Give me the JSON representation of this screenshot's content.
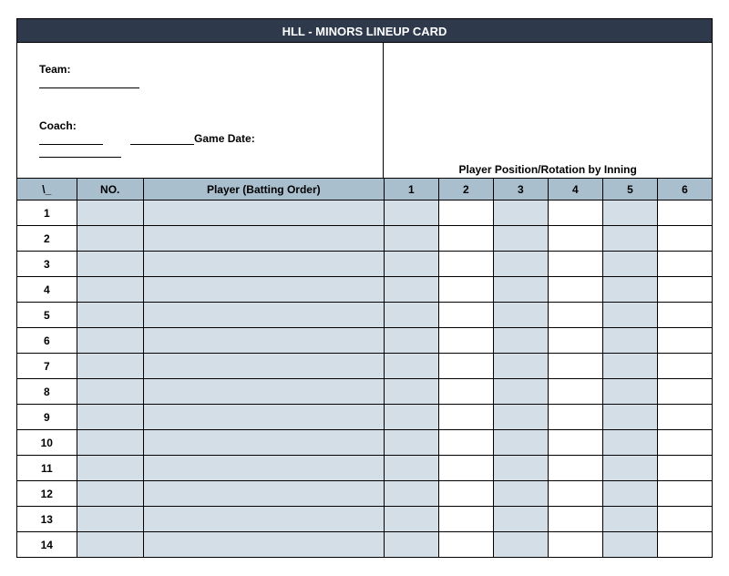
{
  "title": "HLL - MINORS LINEUP CARD",
  "info": {
    "team_label": "Team:",
    "coach_label": "Coach:",
    "date_label": "Game Date:",
    "rotation_label": "Player Position/Rotation by Inning"
  },
  "headers": {
    "corner": "\\_",
    "no": "NO.",
    "player": "Player (Batting Order)",
    "innings": [
      "1",
      "2",
      "3",
      "4",
      "5",
      "6"
    ]
  },
  "rows": [
    {
      "n": "1"
    },
    {
      "n": "2"
    },
    {
      "n": "3"
    },
    {
      "n": "4"
    },
    {
      "n": "5"
    },
    {
      "n": "6"
    },
    {
      "n": "7"
    },
    {
      "n": "8"
    },
    {
      "n": "9"
    },
    {
      "n": "10"
    },
    {
      "n": "11"
    },
    {
      "n": "12"
    },
    {
      "n": "13"
    },
    {
      "n": "14"
    }
  ]
}
